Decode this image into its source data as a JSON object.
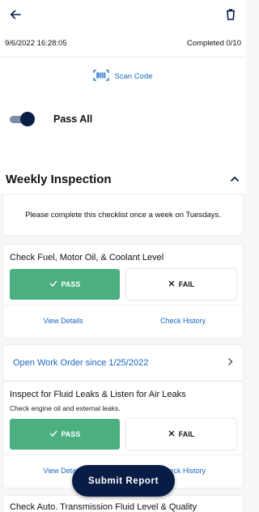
{
  "header": {
    "back_icon": "arrow-left-icon",
    "delete_icon": "trash-icon"
  },
  "meta": {
    "timestamp": "9/6/2022 16:28:05",
    "progress": "Completed 0/10"
  },
  "scan": {
    "label": "Scan Code",
    "icon": "barcode-scan-icon"
  },
  "pass_all": {
    "label": "Pass All",
    "enabled": true
  },
  "section": {
    "title": "Weekly Inspection",
    "collapse_icon": "chevron-up-icon"
  },
  "instructions": "Please complete this checklist once a week on Tuesdays.",
  "items": [
    {
      "title": "Check Fuel, Motor Oil, & Coolant Level",
      "pass_label": "PASS",
      "fail_label": "FAIL",
      "view_details": "View Details",
      "check_history": "Check History"
    },
    {
      "title": "Inspect for Fluid Leaks & Listen for Air Leaks",
      "subtitle": "Check engine oil and external leaks.",
      "pass_label": "PASS",
      "fail_label": "FAIL",
      "view_details": "View Details",
      "check_history": "Check History"
    }
  ],
  "work_order": {
    "label": "Open Work Order since 1/25/2022"
  },
  "next_item_title": "Check Auto. Transmission Fluid Level & Quality",
  "submit_label": "Submit Report",
  "colors": {
    "primary_navy": "#071d46",
    "pass_green": "#4caf82",
    "link_blue": "#1766c4"
  }
}
